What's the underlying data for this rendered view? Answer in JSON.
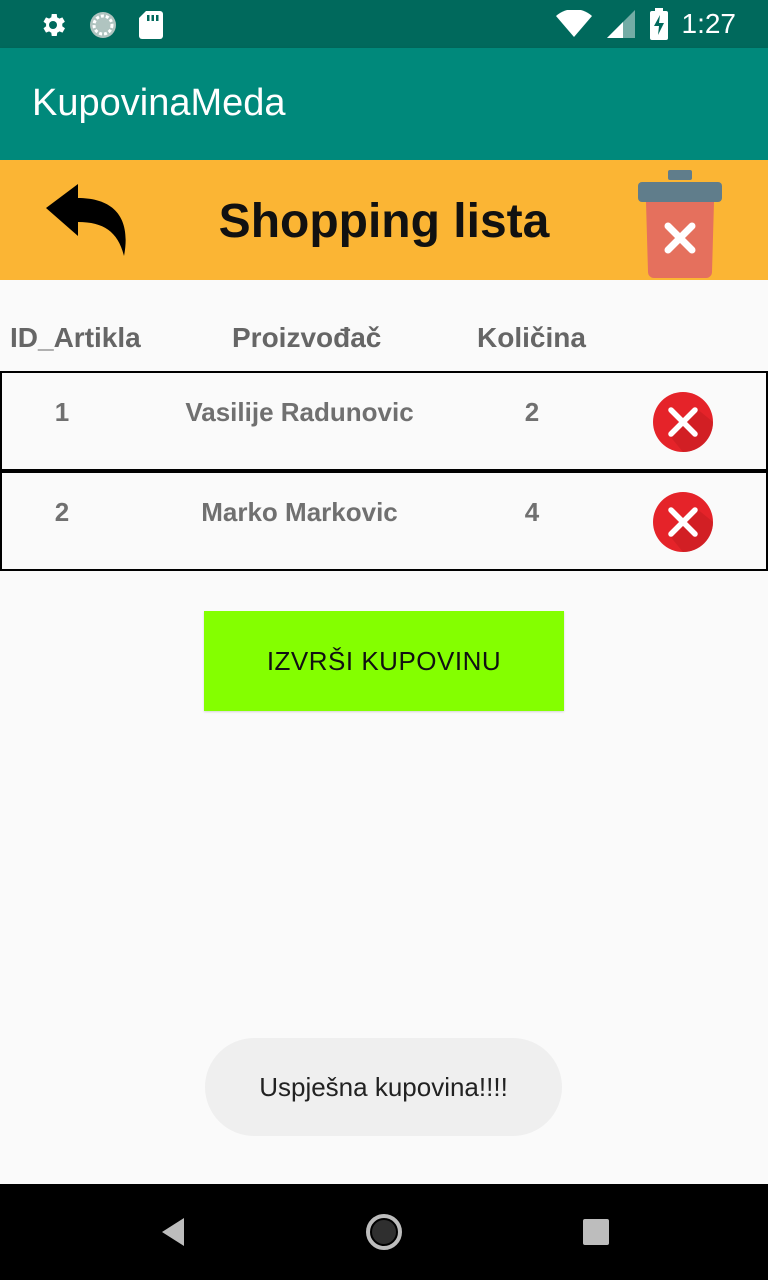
{
  "status_bar": {
    "time": "1:27",
    "icons_left": [
      "settings-icon",
      "sync-icon",
      "sd-card-icon"
    ],
    "icons_right": [
      "wifi-icon",
      "cellular-signal-icon",
      "battery-charging-icon"
    ]
  },
  "app_bar": {
    "title": "KupovinaMeda"
  },
  "header": {
    "title": "Shopping lista",
    "back_icon": "back-arrow-icon",
    "trash_icon": "trash-delete-icon"
  },
  "table": {
    "columns": [
      "ID_Artikla",
      "Proizvođač",
      "Količina"
    ],
    "rows": [
      {
        "id": "1",
        "manufacturer": "Vasilije Radunovic",
        "quantity": "2"
      },
      {
        "id": "2",
        "manufacturer": "Marko Markovic",
        "quantity": "4"
      }
    ]
  },
  "actions": {
    "purchase_label": "IZVRŠI KUPOVINU"
  },
  "toast": {
    "message": "Uspješna kupovina!!!!"
  },
  "colors": {
    "app_bar": "#00897b",
    "status_bar": "#00695c",
    "header_bar": "#fbb534",
    "purchase_button": "#84ff00",
    "delete_red": "#e52329"
  }
}
